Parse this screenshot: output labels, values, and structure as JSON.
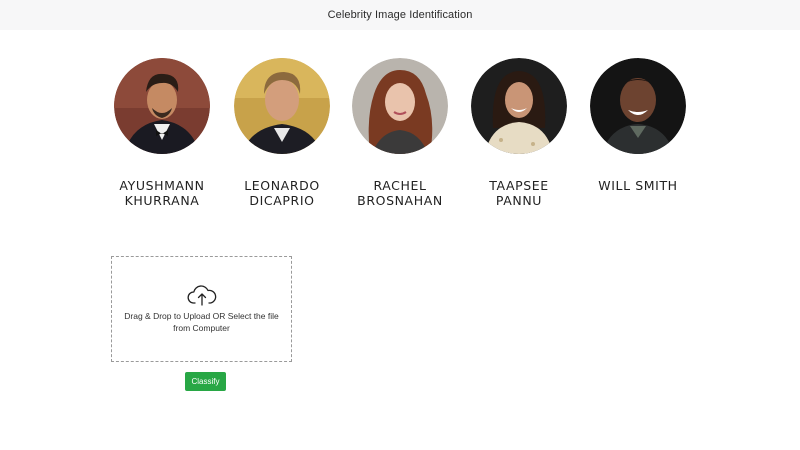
{
  "navbar": {
    "title": "Celebrity Image Identification"
  },
  "celebrities": [
    {
      "name": "AYUSHMANN\nKHURRANA",
      "icon": "portrait-photo"
    },
    {
      "name": "LEONARDO\nDICAPRIO",
      "icon": "portrait-photo"
    },
    {
      "name": "RACHEL\nBROSNAHAN",
      "icon": "portrait-photo"
    },
    {
      "name": "TAAPSEE\nPANNU",
      "icon": "portrait-photo"
    },
    {
      "name": "WILL SMITH",
      "icon": "portrait-photo"
    }
  ],
  "upload": {
    "icon": "cloud-upload-icon",
    "text": "Drag & Drop to Upload OR Select the file from Computer"
  },
  "actions": {
    "classify_label": "Classify",
    "classify_color": "#28a745"
  }
}
